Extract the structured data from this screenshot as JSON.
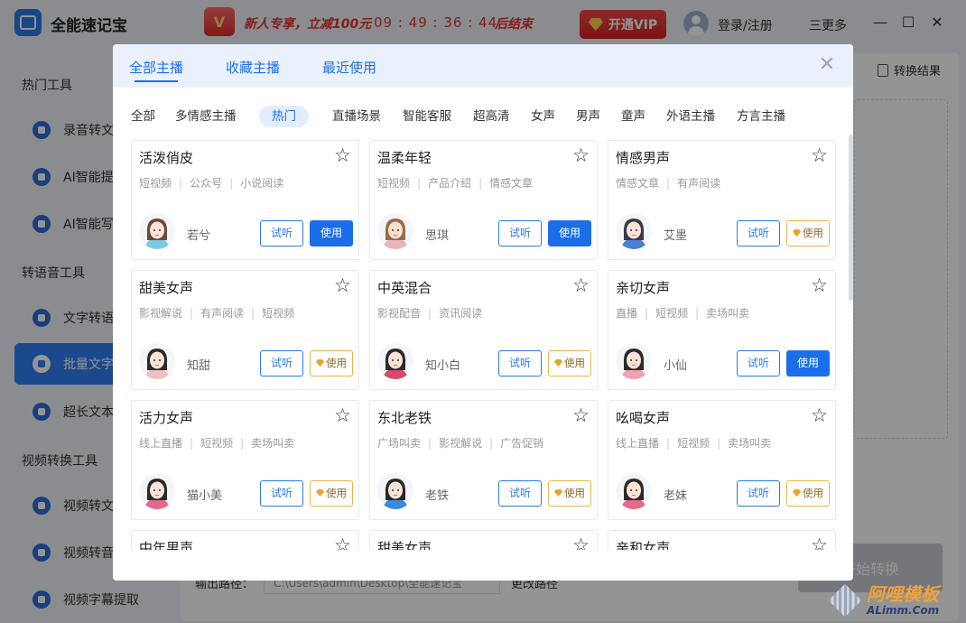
{
  "app": {
    "name": "全能速记宝",
    "promo_badge": "V",
    "promo_text": "新人专享，立减100元",
    "promo_timer": "09 : 49 : 36 : 44",
    "promo_suffix": "后结束",
    "vip_label": "开通VIP",
    "login_label": "登录/注册",
    "more_label": "三更多",
    "window_controls": {
      "minimize": "—",
      "maximize": "☐",
      "close": "✕"
    }
  },
  "sidebar": {
    "sections": [
      {
        "title": "热门工具",
        "items": [
          "录音转文",
          "AI智能提",
          "AI智能写"
        ]
      },
      {
        "title": "转语音工具",
        "items": [
          "文字转语",
          "批量文字",
          "超长文本"
        ]
      },
      {
        "title": "视频转换工具",
        "items": [
          "视频转文",
          "视频转音",
          "视频字幕提取"
        ]
      }
    ],
    "active_item": "批量文字"
  },
  "main": {
    "convert_result": "转换结果",
    "output_label": "输出路径：",
    "output_path": "C:\\Users\\admin\\Desktop\\全能速记宝",
    "change_path": "更改路径",
    "start_button": "开始转换"
  },
  "modal": {
    "tabs": [
      "全部主播",
      "收藏主播",
      "最近使用"
    ],
    "active_tab": "全部主播",
    "close_icon": "close-icon",
    "categories": [
      "全部",
      "多情感主播",
      "热门",
      "直播场景",
      "智能客服",
      "超高清",
      "女声",
      "男声",
      "童声",
      "外语主播",
      "方言主播"
    ],
    "active_category": "热门",
    "try_label": "试听",
    "use_label": "使用",
    "cards": [
      {
        "name": "活泼俏皮",
        "tags": [
          "短视频",
          "公众号",
          "小说阅读"
        ],
        "anchor": "若兮",
        "vip": false,
        "avatar": {
          "skin": "#fde3d6",
          "hair": "#6b4a3a",
          "shirt": "#7ec8e3"
        }
      },
      {
        "name": "温柔年轻",
        "tags": [
          "短视频",
          "产品介绍",
          "情感文章"
        ],
        "anchor": "思琪",
        "vip": false,
        "avatar": {
          "skin": "#fbe0d0",
          "hair": "#9a6a4a",
          "shirt": "#e8b4b8"
        }
      },
      {
        "name": "情感男声",
        "tags": [
          "情感文章",
          "有声阅读"
        ],
        "anchor": "艾墨",
        "vip": true,
        "avatar": {
          "skin": "#fde3d6",
          "hair": "#3a3a4a",
          "shirt": "#4a7fd6"
        }
      },
      {
        "name": "甜美女声",
        "tags": [
          "影视解说",
          "有声阅读",
          "短视频"
        ],
        "anchor": "知甜",
        "vip": true,
        "avatar": {
          "skin": "#fde3d6",
          "hair": "#2a2a2a",
          "shirt": "#f0c0c0"
        }
      },
      {
        "name": "中英混合",
        "tags": [
          "影视配音",
          "资讯阅读"
        ],
        "anchor": "知小白",
        "vip": true,
        "avatar": {
          "skin": "#fde3d6",
          "hair": "#2a2a2a",
          "shirt": "#d84a6a"
        }
      },
      {
        "name": "亲切女声",
        "tags": [
          "直播",
          "短视频",
          "卖场叫卖"
        ],
        "anchor": "小仙",
        "vip": false,
        "avatar": {
          "skin": "#fde3d6",
          "hair": "#2a2a2a",
          "shirt": "#f0a0b0"
        }
      },
      {
        "name": "活力女声",
        "tags": [
          "线上直播",
          "短视频",
          "卖场叫卖"
        ],
        "anchor": "猫小美",
        "vip": true,
        "avatar": {
          "skin": "#fde3d6",
          "hair": "#2a2a2a",
          "shirt": "#e46a8a"
        }
      },
      {
        "name": "东北老铁",
        "tags": [
          "广场叫卖",
          "影视解说",
          "广告促销"
        ],
        "anchor": "老铁",
        "vip": true,
        "avatar": {
          "skin": "#fde3d6",
          "hair": "#2a2a2a",
          "shirt": "#3a8ae0"
        }
      },
      {
        "name": "吆喝女声",
        "tags": [
          "线上直播",
          "短视频",
          "卖场叫卖"
        ],
        "anchor": "老妹",
        "vip": true,
        "avatar": {
          "skin": "#fde3d6",
          "hair": "#2a2a2a",
          "shirt": "#e46a8a"
        }
      },
      {
        "name": "中年男声",
        "tags": [],
        "anchor": "",
        "vip": true,
        "avatar": {
          "skin": "#fde3d6",
          "hair": "#2a2a2a",
          "shirt": "#3a8ae0"
        }
      },
      {
        "name": "甜美女声",
        "tags": [],
        "anchor": "",
        "vip": true,
        "avatar": {
          "skin": "#fde3d6",
          "hair": "#2a2a2a",
          "shirt": "#e46a8a"
        }
      },
      {
        "name": "亲和女声",
        "tags": [],
        "anchor": "",
        "vip": true,
        "avatar": {
          "skin": "#fde3d6",
          "hair": "#2a2a2a",
          "shirt": "#e46a8a"
        }
      }
    ]
  },
  "watermark": {
    "line1": "阿哩模板",
    "line2": "ALimm.Com"
  },
  "colors": {
    "accent": "#1e6fe6",
    "vip": "#e8b64a",
    "promo": "#e53333"
  }
}
